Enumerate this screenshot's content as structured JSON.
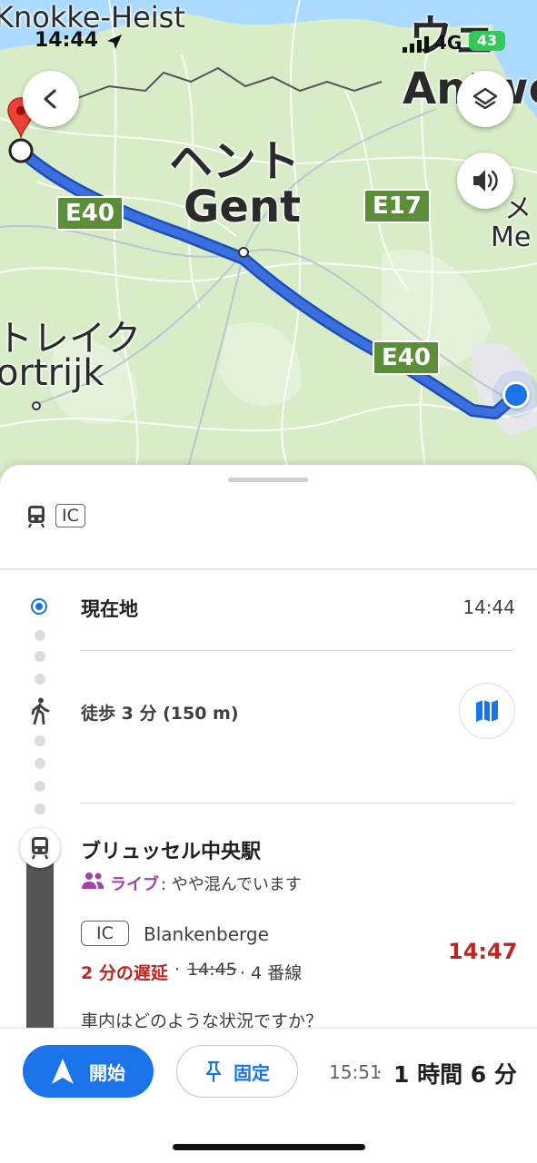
{
  "status_bar": {
    "time": "14:44",
    "network": "4G",
    "battery": "43"
  },
  "map": {
    "labels": {
      "knokke": "Knokke-Heist",
      "gent_jp": "ヘント",
      "gent": "Gent",
      "kortrijk_jp": "トレイク",
      "kortrijk": "ortrijk",
      "antwerp_jp": "ウェ",
      "antwerp": "Antwe",
      "mechelen_jp": "メ",
      "mechelen": "Me"
    },
    "shields": [
      "E40",
      "E17",
      "E40"
    ]
  },
  "sheet": {
    "header": {
      "train_icon": "train-icon",
      "service_chip": "IC"
    },
    "origin": {
      "label": "現在地",
      "time": "14:44"
    },
    "walk": {
      "label": "徒歩 3 分 (150 m)"
    },
    "station": {
      "name": "ブリュッセル中央駅",
      "live_label": "ライブ",
      "crowd_text": ": やや混んでいます",
      "line_chip": "IC",
      "destination": "Blankenberge",
      "delay_text": "2 分の遅延",
      "sep1": " · ",
      "scheduled_time": "14:45",
      "platform": " · 4 番線",
      "actual_time": "14:47",
      "question": "車内はどのような状況ですか？"
    }
  },
  "bottom": {
    "start_label": "開始",
    "pin_label": "固定",
    "arrival": "15:51",
    "sep": " · ",
    "duration": "1 時間 6 分"
  },
  "colors": {
    "route": "#3b6fe0",
    "accent": "#1a73e8",
    "delay_red": "#c5221f",
    "live_purple": "#a142a5",
    "shield": "#5c8e3a"
  }
}
